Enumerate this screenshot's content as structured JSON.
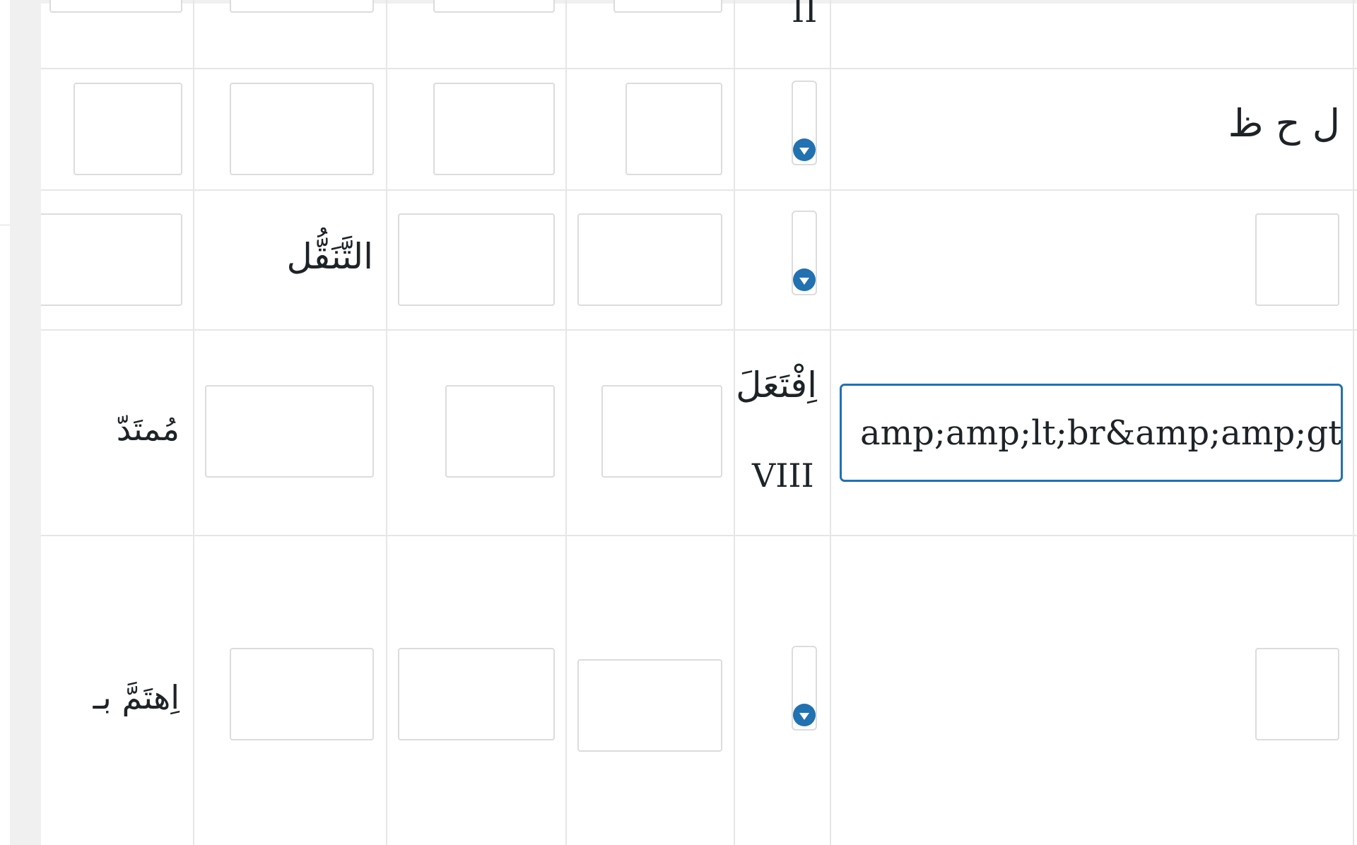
{
  "rows": {
    "top": {
      "form_number": "II"
    },
    "row1": {
      "root": "ل ح ظ"
    },
    "row2": {
      "verbal_noun": "التَّنَقُّل"
    },
    "row3": {
      "form_arabic": "اِفْتَعَلَ",
      "form_number": "VIII",
      "active_input_value": "amp;amp;lt;br&amp;amp;gt&",
      "participle": "مُمتَدّ"
    },
    "row4": {
      "verb": "اِهتَمَّ بـ"
    }
  },
  "icons": {
    "select_arrow": "chevron-down-circle-icon"
  },
  "colors": {
    "accent": "#2271b1",
    "border": "#dcdcde",
    "grid": "#e6e6e6"
  }
}
